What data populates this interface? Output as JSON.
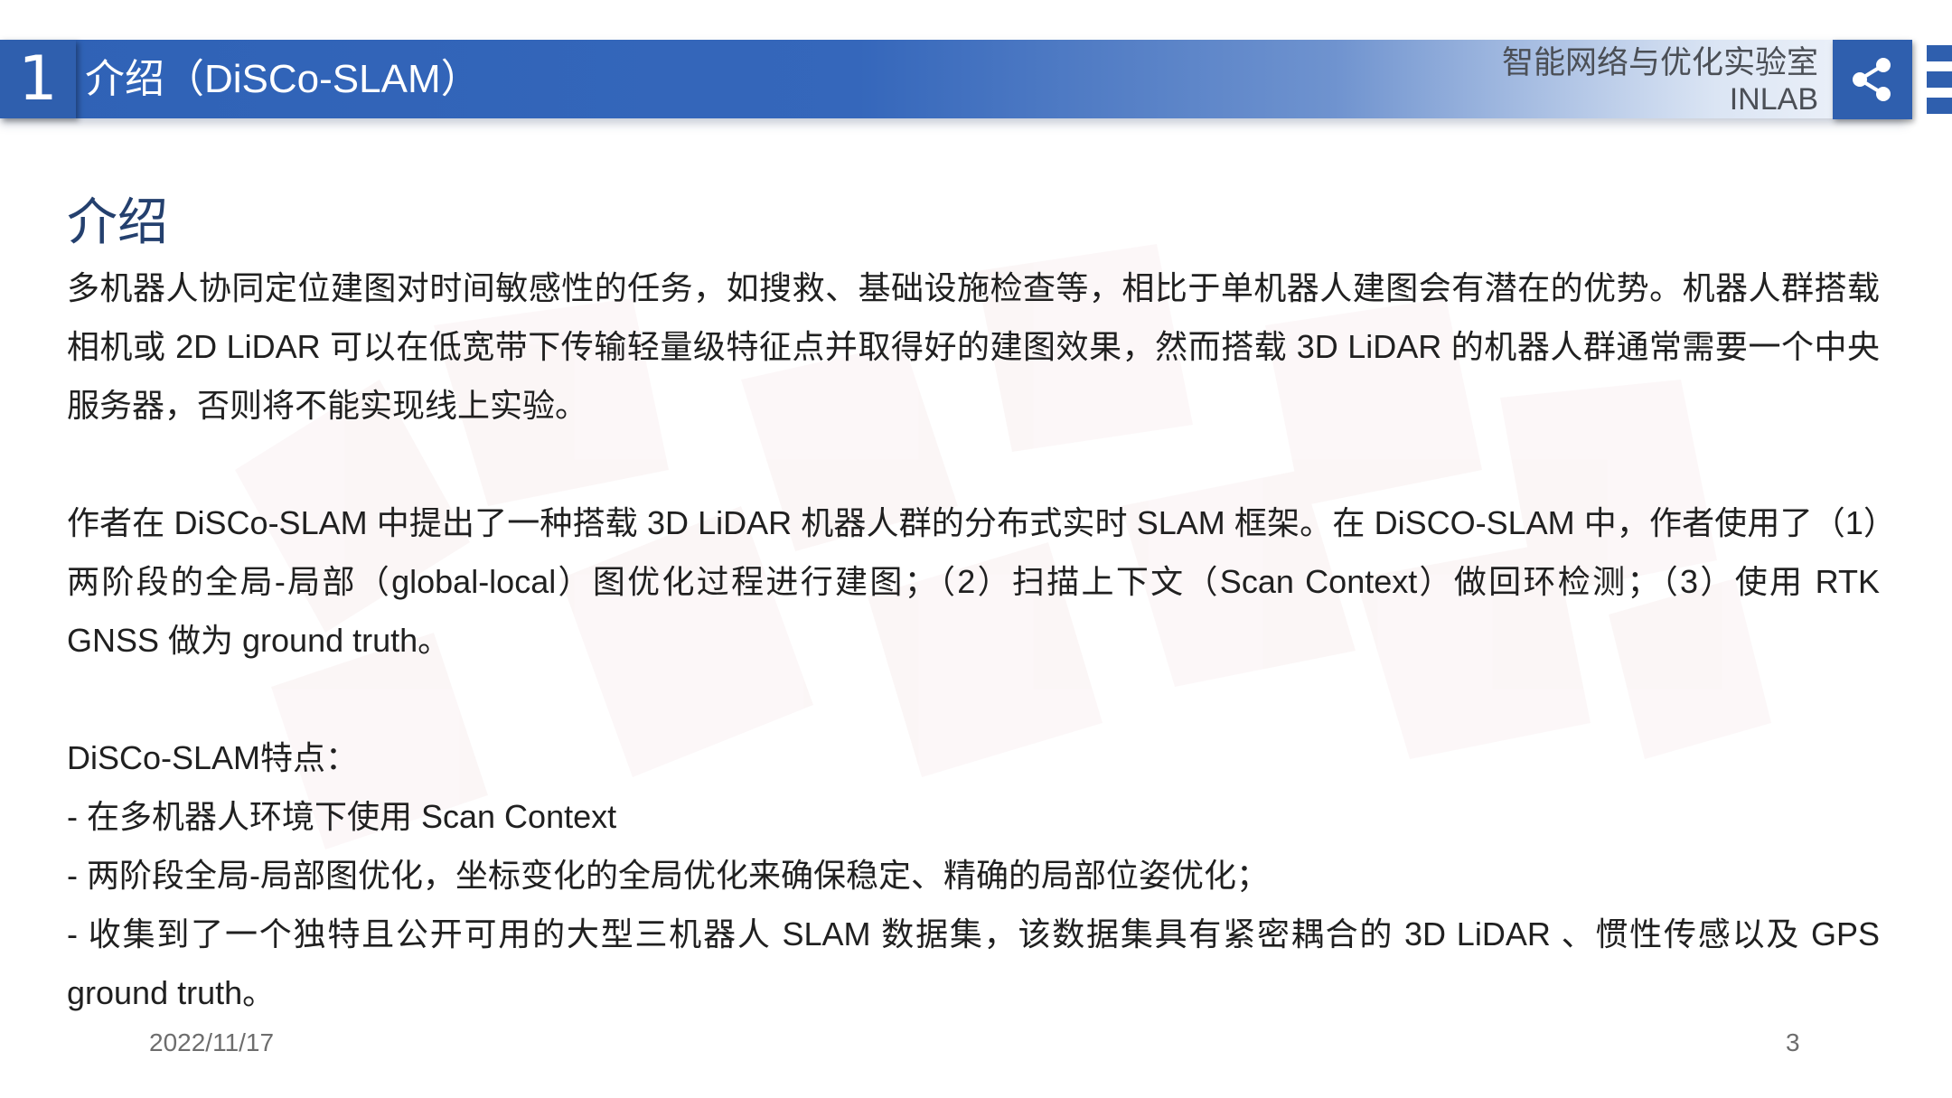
{
  "header": {
    "section_number": "1",
    "title": "介绍（DiSCo-SLAM）",
    "lab_name": "智能网络与优化实验室",
    "lab_abbr": "INLAB",
    "share_icon": "share-icon",
    "accent_color": "#2f5fae"
  },
  "content": {
    "heading": "介绍",
    "paragraphs": [
      "多机器人协同定位建图对时间敏感性的任务，如搜救、基础设施检查等，相比于单机器人建图会有潜在的优势。机器人群搭载相机或 2D LiDAR 可以在低宽带下传输轻量级特征点并取得好的建图效果，然而搭载 3D LiDAR 的机器人群通常需要一个中央服务器，否则将不能实现线上实验。",
      "作者在 DiSCo-SLAM 中提出了一种搭载 3D LiDAR 机器人群的分布式实时 SLAM 框架。在 DiSCO-SLAM 中，作者使用了（1）两阶段的全局-局部（global-local）图优化过程进行建图；（2）扫描上下文（Scan Context）做回环检测；（3）使用 RTK GNSS 做为 ground truth。"
    ],
    "features_title": "DiSCo-SLAM特点：",
    "features": [
      "- 在多机器人环境下使用 Scan Context",
      "- 两阶段全局-局部图优化，坐标变化的全局优化来确保稳定、精确的局部位姿优化；",
      "- 收集到了一个独特且公开可用的大型三机器人 SLAM 数据集，该数据集具有紧密耦合的 3D LiDAR 、惯性传感以及 GPS ground truth。"
    ]
  },
  "footer": {
    "date": "2022/11/17",
    "page": "3"
  }
}
